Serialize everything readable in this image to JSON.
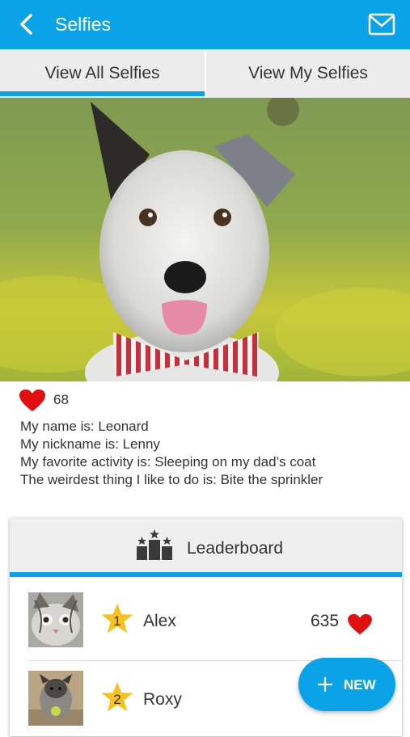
{
  "appbar": {
    "title": "Selfies",
    "back_icon": "chevron-left-icon",
    "mail_icon": "mail-icon"
  },
  "tabs": [
    {
      "label": "View All Selfies",
      "active": true
    },
    {
      "label": "View My Selfies",
      "active": false
    }
  ],
  "selfie": {
    "image": "dog-photo",
    "likes": "68",
    "info": [
      "My name is: Leonard",
      "My nickname is: Lenny",
      "My favorite activity is: Sleeping on my dad’s coat",
      "The weirdest thing I like to do is: Bite the sprinkler"
    ]
  },
  "leaderboard": {
    "title": "Leaderboard",
    "icon": "podium-icon",
    "entries": [
      {
        "rank": "1",
        "name": "Alex",
        "score": "635",
        "avatar": "cat-avatar"
      },
      {
        "rank": "2",
        "name": "Roxy",
        "score": "",
        "avatar": "puppy-avatar"
      }
    ]
  },
  "fab": {
    "label": "NEW",
    "icon": "plus-icon"
  },
  "colors": {
    "primary": "#0aa3e8",
    "heart": "#e01010",
    "star": "#f7c21a"
  }
}
